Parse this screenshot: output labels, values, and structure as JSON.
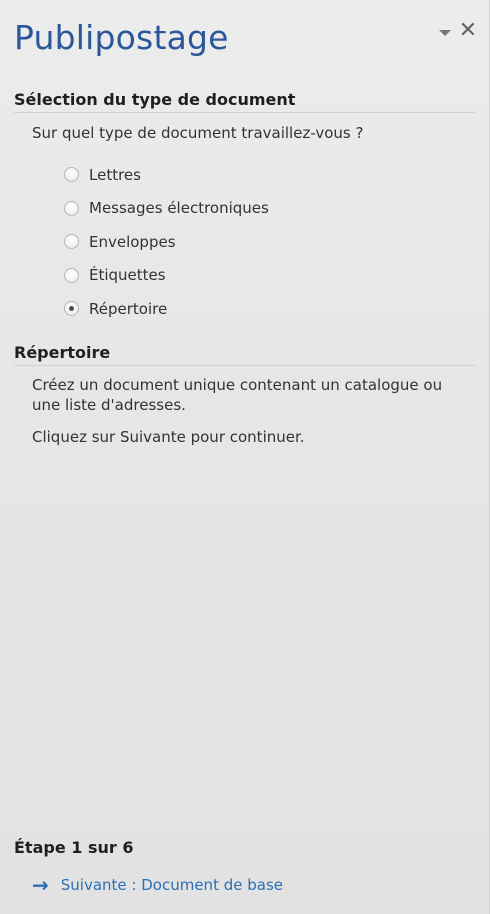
{
  "pane": {
    "title": "Publipostage",
    "close_glyph": "✕",
    "menu_icon": "dropdown-arrow-icon"
  },
  "section1": {
    "heading": "Sélection du type de document",
    "question": "Sur quel type de document travaillez-vous ?",
    "options": [
      {
        "label": "Lettres",
        "checked": false
      },
      {
        "label": "Messages électroniques",
        "checked": false
      },
      {
        "label": "Enveloppes",
        "checked": false
      },
      {
        "label": "Étiquettes",
        "checked": false
      },
      {
        "label": "Répertoire",
        "checked": true
      }
    ]
  },
  "section2": {
    "heading": "Répertoire",
    "description": "Créez un document unique contenant un catalogue ou une liste d'adresses.",
    "instruction": "Cliquez sur Suivante pour continuer."
  },
  "footer": {
    "step": "Étape 1 sur 6",
    "next_arrow": "→",
    "next_label": "Suivante : Document de base"
  }
}
